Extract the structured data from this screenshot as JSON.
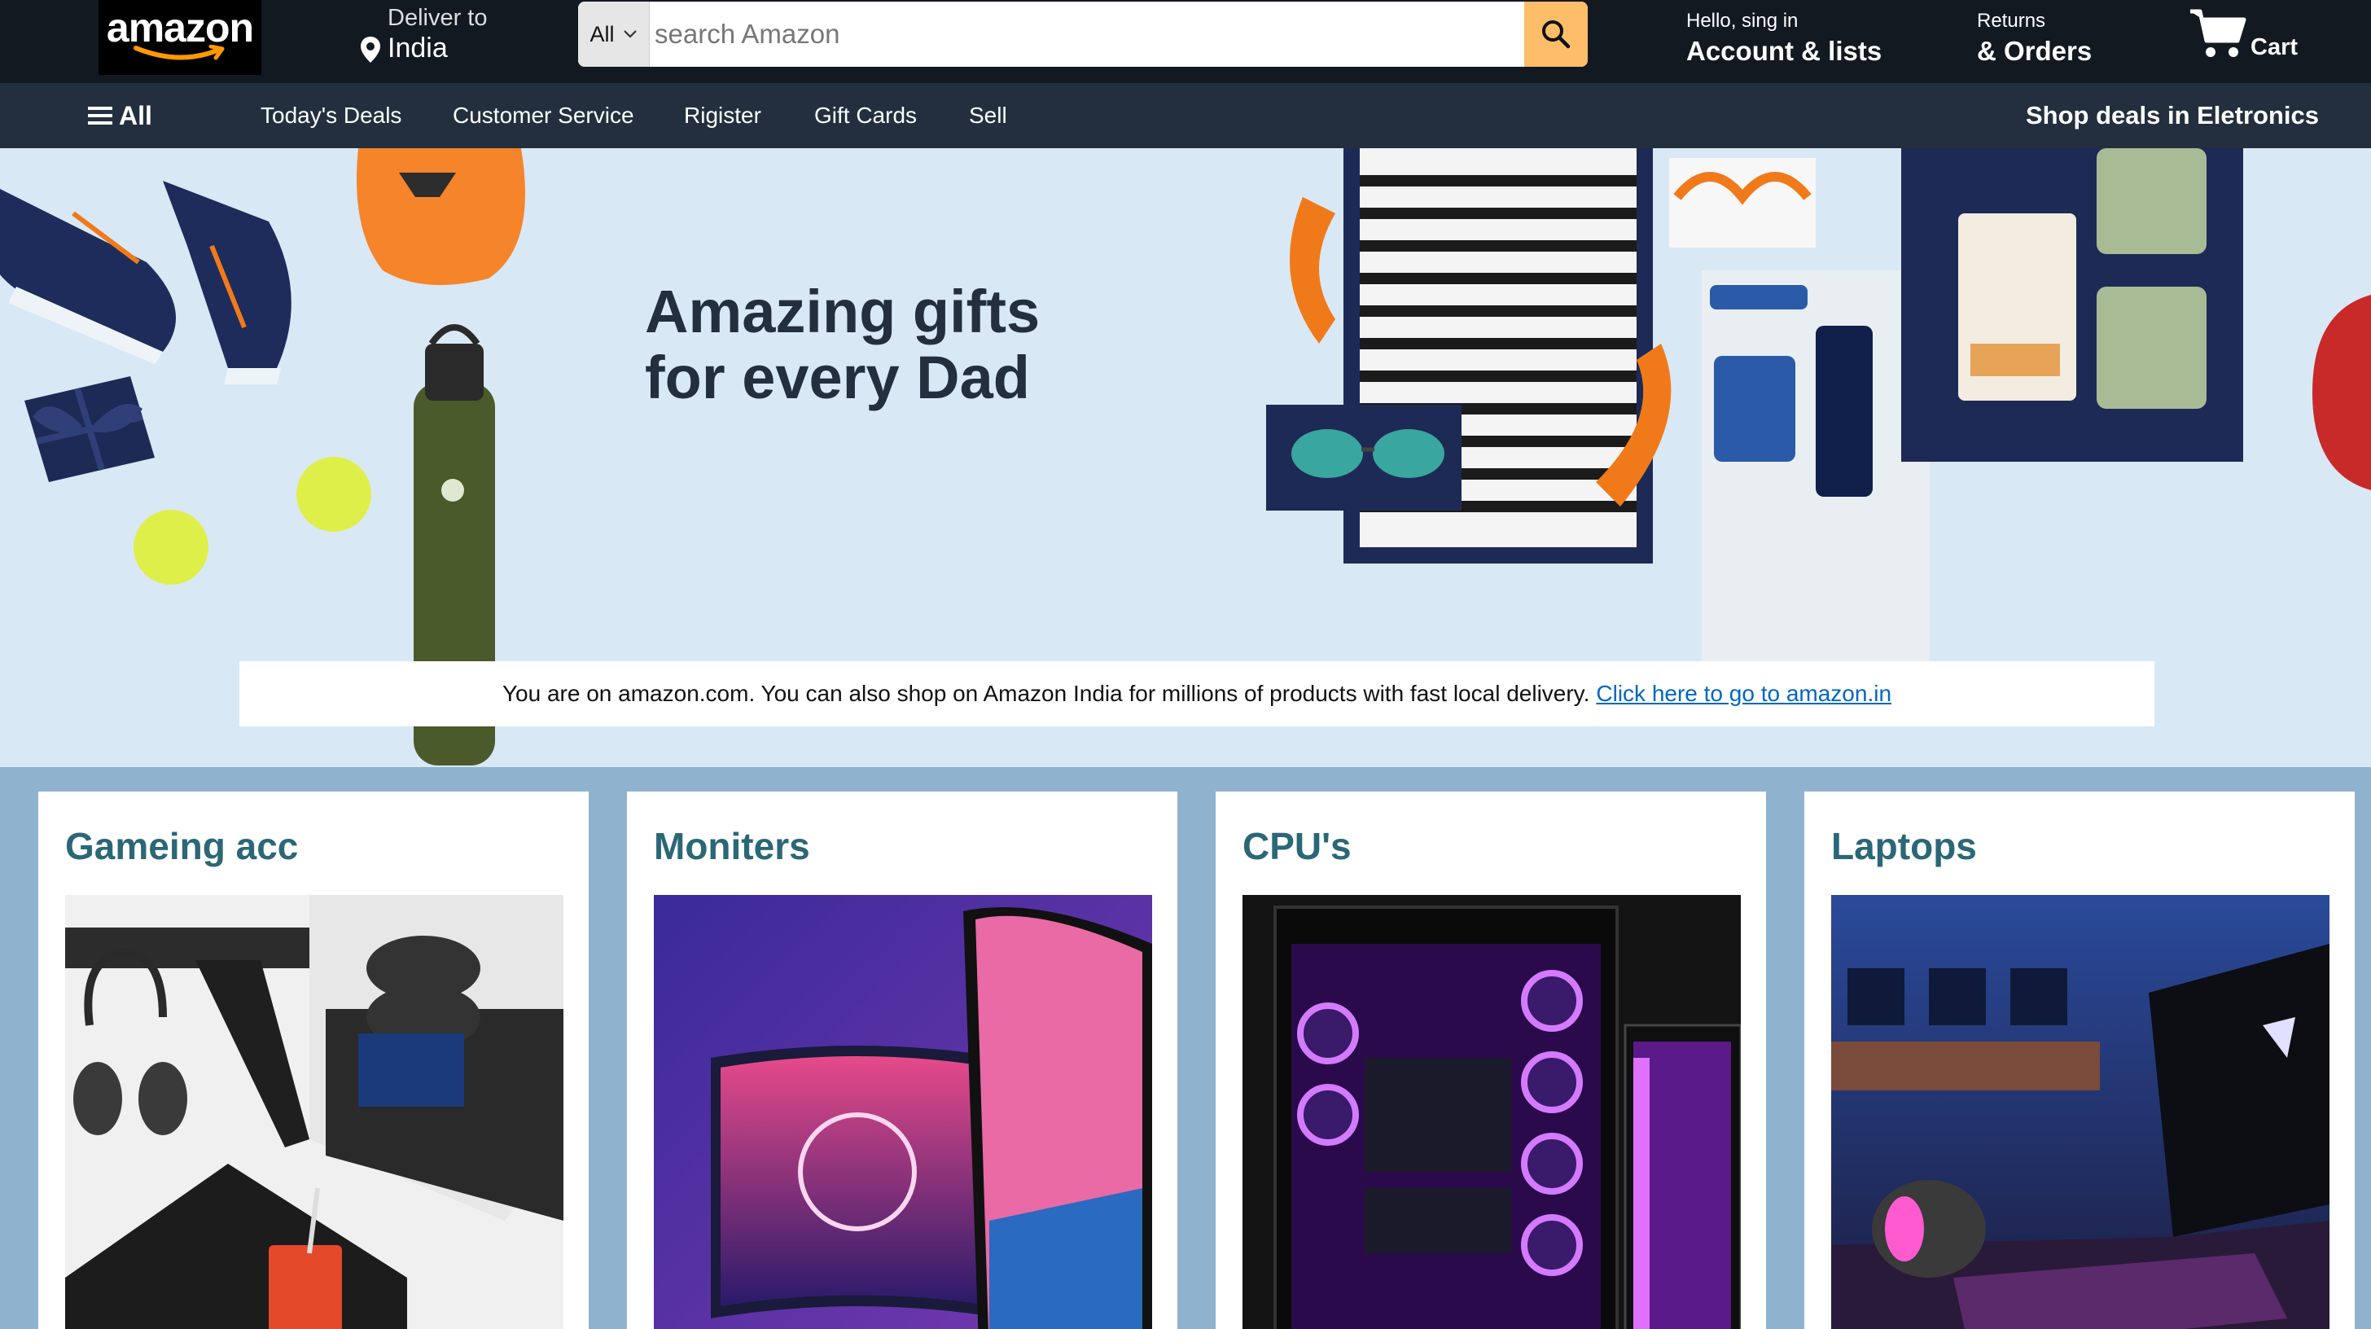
{
  "header": {
    "logo_text": "amazon",
    "deliver_label": "Deliver to",
    "deliver_location": "India",
    "search": {
      "category": "All",
      "placeholder": "search Amazon"
    },
    "account_greeting": "Hello, sing in",
    "account_label": "Account & lists",
    "returns_label": "Returns",
    "orders_label": "& Orders",
    "cart_label": "Cart"
  },
  "subnav": {
    "all_label": "All",
    "items": [
      "Today's Deals",
      "Customer Service",
      "Rigister",
      "Gift Cards",
      "Sell"
    ],
    "promo": "Shop deals in Eletronics"
  },
  "hero": {
    "title_line1": "Amazing gifts",
    "title_line2": "for every Dad",
    "notice_text": "You are on amazon.com. You can also shop on Amazon India for millions of products with fast local delivery.",
    "notice_link": "Click here to go to amazon.in"
  },
  "cards": [
    {
      "title": "Gameing acc"
    },
    {
      "title": "Moniters"
    },
    {
      "title": "CPU's"
    },
    {
      "title": "Laptops"
    }
  ],
  "colors": {
    "nav_bg": "#131921",
    "subnav_bg": "#232f3e",
    "search_button": "#febd69",
    "hero_bg": "#d9e8f5",
    "cards_bg": "#8fb3cf",
    "card_title": "#2b6777",
    "link": "#0066c0"
  },
  "icons": [
    "location-pin-icon",
    "chevron-down-icon",
    "search-icon",
    "cart-icon",
    "hamburger-menu-icon"
  ]
}
